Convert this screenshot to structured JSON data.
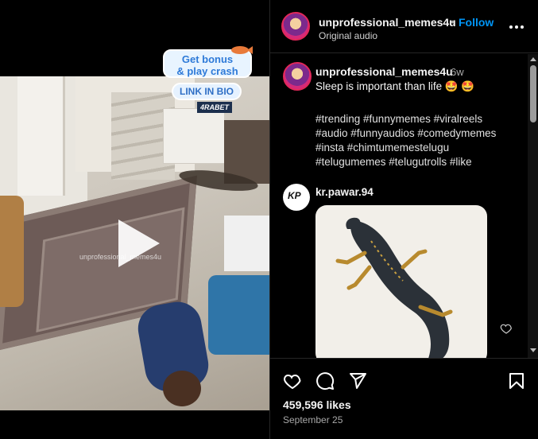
{
  "video": {
    "watermark": "unprofessional_memes4u",
    "promo_line1": "Get bonus",
    "promo_line2": "& play crash",
    "link_in_bio": "LINK IN BIO",
    "brand": "4RABET"
  },
  "header": {
    "username": "unprofessional_memes4u",
    "separator": "•",
    "follow_label": "Follow",
    "subtitle": "Original audio"
  },
  "caption": {
    "username": "unprofessional_memes4u",
    "time": "6w",
    "text": "Sleep is important than life 🤩 🤩",
    "hashtags": [
      "#trending #funnymemes #viralreels",
      "#audio #funnyaudios #comedymemes",
      "#insta #chimtumemestelugu",
      "#telugumemes #telugutrolls #like"
    ]
  },
  "comment": {
    "username": "kr.pawar.94",
    "avatar_text": "KP"
  },
  "footer": {
    "likes": "459,596 likes",
    "date": "September 25"
  },
  "colors": {
    "accent": "#0095f6",
    "background": "#000000",
    "divider": "#262626",
    "muted_text": "#a8a8a8"
  },
  "icons": {
    "play": "play-icon",
    "more": "more-options-icon",
    "like": "heart-icon",
    "comment": "comment-icon",
    "share": "send-icon",
    "save": "bookmark-icon"
  }
}
